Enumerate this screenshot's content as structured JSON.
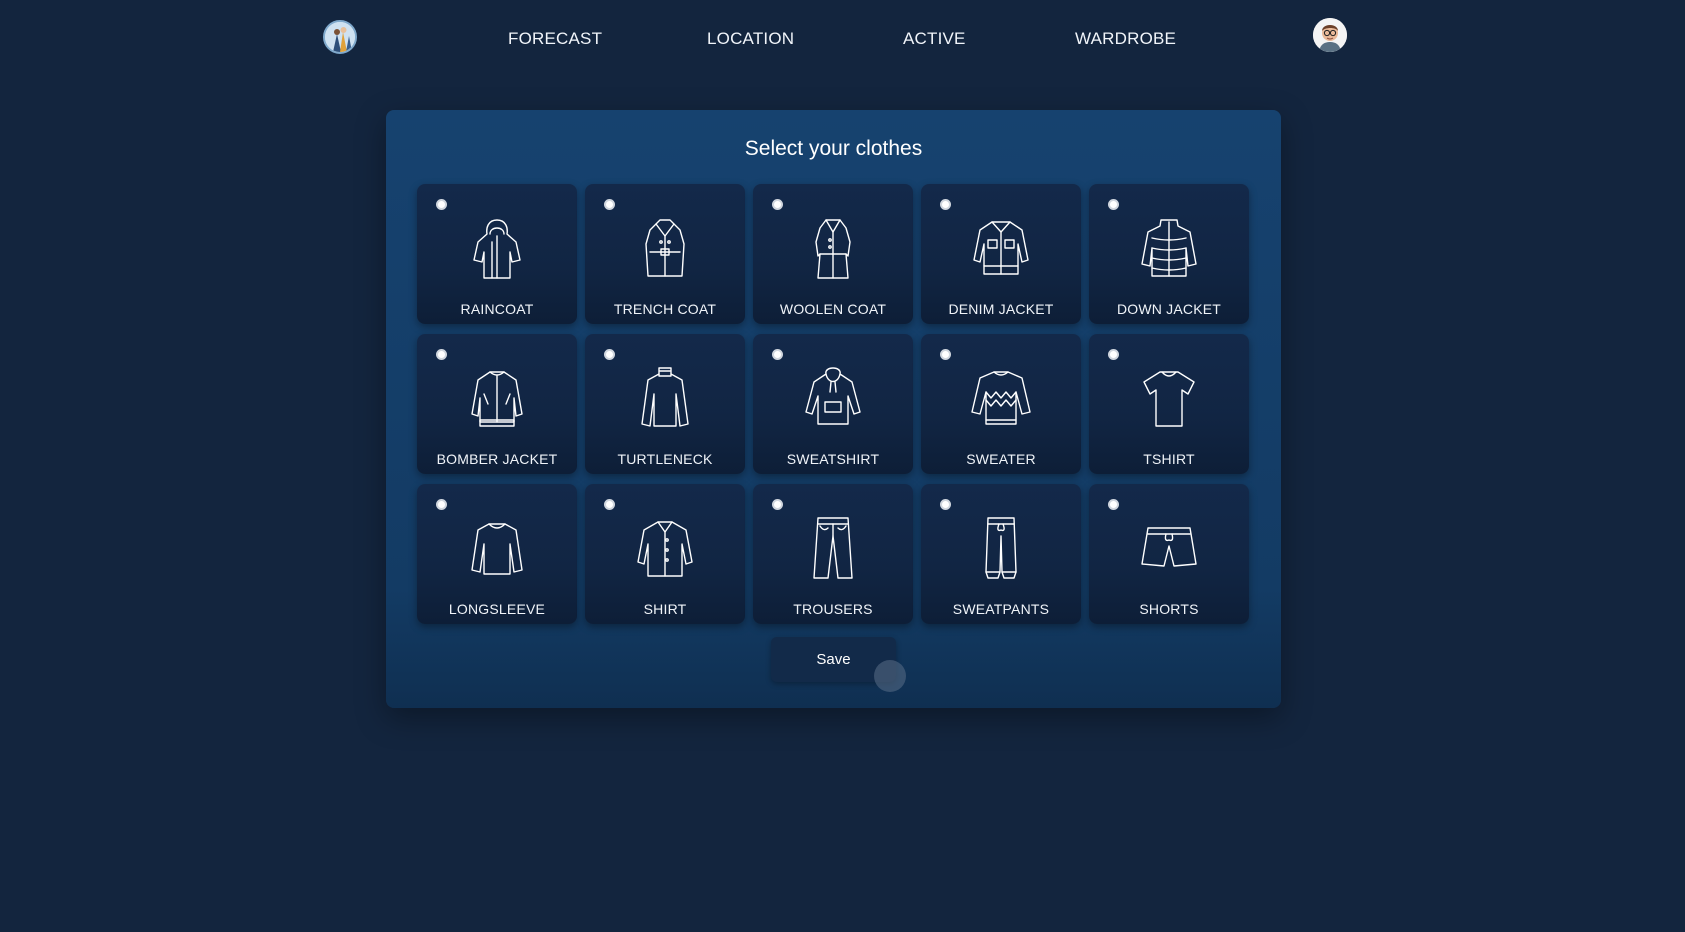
{
  "nav": {
    "logo_icon": "weather-person-logo-icon",
    "links": [
      "FORECAST",
      "LOCATION",
      "ACTIVE",
      "WARDROBE"
    ],
    "avatar_icon": "user-avatar-icon"
  },
  "panel": {
    "title": "Select your clothes",
    "save_label": "Save"
  },
  "clothes": [
    {
      "label": "RAINCOAT",
      "icon": "raincoat-icon"
    },
    {
      "label": "TRENCH COAT",
      "icon": "trench-coat-icon"
    },
    {
      "label": "WOOLEN COAT",
      "icon": "woolen-coat-icon"
    },
    {
      "label": "DENIM JACKET",
      "icon": "denim-jacket-icon"
    },
    {
      "label": "DOWN JACKET",
      "icon": "down-jacket-icon"
    },
    {
      "label": "BOMBER JACKET",
      "icon": "bomber-jacket-icon"
    },
    {
      "label": "TURTLENECK",
      "icon": "turtleneck-icon"
    },
    {
      "label": "SWEATSHIRT",
      "icon": "sweatshirt-icon"
    },
    {
      "label": "SWEATER",
      "icon": "sweater-icon"
    },
    {
      "label": "TSHIRT",
      "icon": "tshirt-icon"
    },
    {
      "label": "LONGSLEEVE",
      "icon": "longsleeve-icon"
    },
    {
      "label": "SHIRT",
      "icon": "shirt-icon"
    },
    {
      "label": "TROUSERS",
      "icon": "trousers-icon"
    },
    {
      "label": "SWEATPANTS",
      "icon": "sweatpants-icon"
    },
    {
      "label": "SHORTS",
      "icon": "shorts-icon"
    }
  ],
  "colors": {
    "background": "#13253e",
    "panel": "#16426f",
    "card": "#13294a",
    "text": "#f0f4f9"
  }
}
